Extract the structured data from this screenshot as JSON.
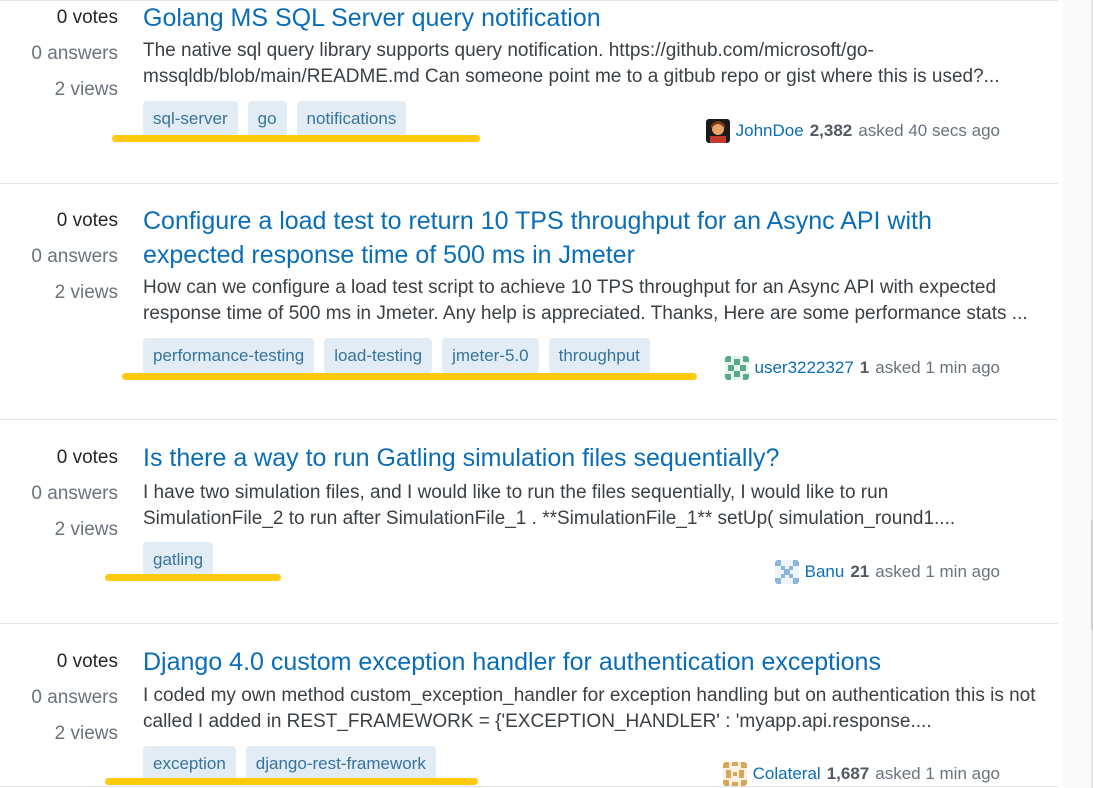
{
  "questions": [
    {
      "votes": "0 votes",
      "answers": "0 answers",
      "views": "2 views",
      "title": "Golang MS SQL Server query notification",
      "excerpt": "The native sql query library supports query notification. https://github.com/microsoft/go-mssqldb/blob/main/README.md Can someone point me to a gitbub repo or gist where this is used?...",
      "tags": [
        "sql-server",
        "go",
        "notifications"
      ],
      "user": {
        "name": "JohnDoe",
        "rep": "2,382",
        "asked": "asked 40 secs ago",
        "avatar": "photo-avatar-icon"
      }
    },
    {
      "votes": "0 votes",
      "answers": "0 answers",
      "views": "2 views",
      "title": "Configure a load test to return 10 TPS throughput for an Async API with expected response time of 500 ms in Jmeter",
      "excerpt": "How can we configure a load test script to achieve 10 TPS throughput for an Async API with expected response time of 500 ms in Jmeter. Any help is appreciated. Thanks, Here are some performance stats ...",
      "tags": [
        "performance-testing",
        "load-testing",
        "jmeter-5.0",
        "throughput"
      ],
      "user": {
        "name": "user3222327",
        "rep": "1",
        "asked": "asked 1 min ago",
        "avatar": "identicon-icon"
      }
    },
    {
      "votes": "0 votes",
      "answers": "0 answers",
      "views": "2 views",
      "title": "Is there a way to run Gatling simulation files sequentially?",
      "excerpt": "I have two simulation files, and I would like to run the files sequentially, I would like to run SimulationFile_2 to run after SimulationFile_1 . **SimulationFile_1** setUp( simulation_round1....",
      "tags": [
        "gatling"
      ],
      "user": {
        "name": "Banu",
        "rep": "21",
        "asked": "asked 1 min ago",
        "avatar": "identicon-icon"
      }
    },
    {
      "votes": "0 votes",
      "answers": "0 answers",
      "views": "2 views",
      "title": "Django 4.0 custom exception handler for authentication exceptions",
      "excerpt": "I coded my own method custom_exception_handler for exception handling but on authentication this is not called I added in REST_FRAMEWORK = {'EXCEPTION_HANDLER' : 'myapp.api.response....",
      "tags": [
        "exception",
        "django-rest-framework"
      ],
      "user": {
        "name": "Colateral",
        "rep": "1,687",
        "asked": "asked 1 min ago",
        "avatar": "identicon-icon"
      }
    }
  ],
  "colors": {
    "link": "#0a6db8",
    "tag_bg": "#e1ecf4",
    "tag_text": "#39739d",
    "highlight": "#ffc90e"
  }
}
